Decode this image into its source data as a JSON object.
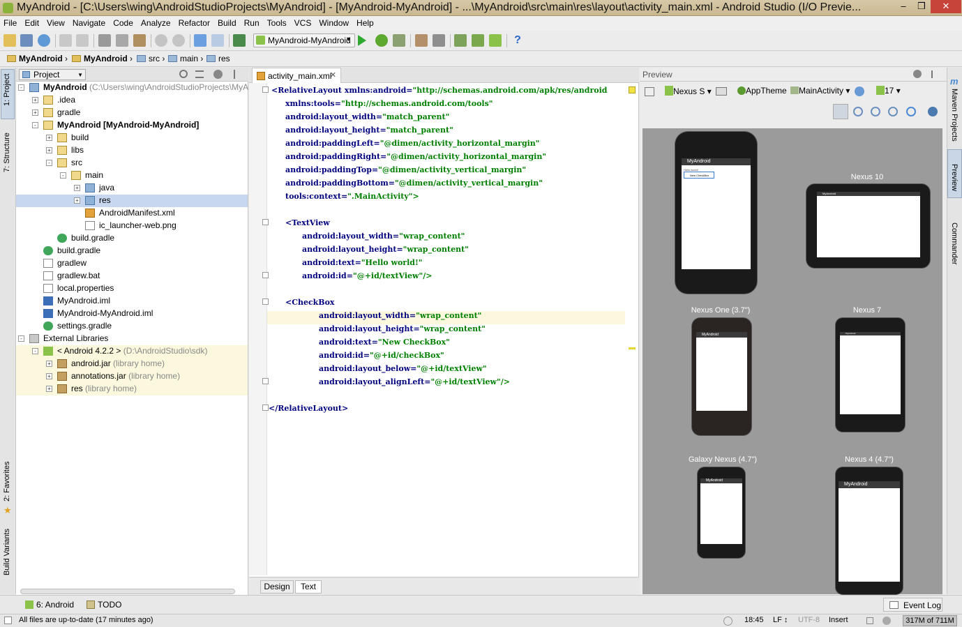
{
  "window": {
    "title": "MyAndroid - [C:\\Users\\wing\\AndroidStudioProjects\\MyAndroid] - [MyAndroid-MyAndroid] - ...\\MyAndroid\\src\\main\\res\\layout\\activity_main.xml - Android Studio (I/O Previe...",
    "min": "–",
    "max": "❒",
    "close": "✕"
  },
  "menu": [
    "File",
    "Edit",
    "View",
    "Navigate",
    "Code",
    "Analyze",
    "Refactor",
    "Build",
    "Run",
    "Tools",
    "VCS",
    "Window",
    "Help"
  ],
  "toolbar": {
    "run_config": "MyAndroid-MyAndroid",
    "help": "?"
  },
  "breadcrumbs": [
    "MyAndroid",
    "MyAndroid",
    "src",
    "main",
    "res"
  ],
  "left_tools": {
    "project": "1: Project",
    "structure": "7: Structure",
    "favorites": "2: Favorites",
    "build_variants": "Build Variants"
  },
  "project": {
    "header": "Project",
    "tree": [
      {
        "label": "MyAndroid",
        "extra": "(C:\\Users\\wing\\AndroidStudioProjects\\MyAndro",
        "bold": true
      },
      {
        "label": ".idea"
      },
      {
        "label": "gradle"
      },
      {
        "label": "MyAndroid [MyAndroid-MyAndroid]",
        "bold": true
      },
      {
        "label": "build"
      },
      {
        "label": "libs"
      },
      {
        "label": "src"
      },
      {
        "label": "main"
      },
      {
        "label": "java"
      },
      {
        "label": "res"
      },
      {
        "label": "AndroidManifest.xml"
      },
      {
        "label": "ic_launcher-web.png"
      },
      {
        "label": "build.gradle"
      },
      {
        "label": "build.gradle"
      },
      {
        "label": "gradlew"
      },
      {
        "label": "gradlew.bat"
      },
      {
        "label": "local.properties"
      },
      {
        "label": "MyAndroid.iml"
      },
      {
        "label": "MyAndroid-MyAndroid.iml"
      },
      {
        "label": "settings.gradle"
      },
      {
        "label": "External Libraries"
      },
      {
        "label": "< Android 4.2.2 >",
        "extra": "(D:\\AndroidStudio\\sdk)"
      },
      {
        "label": "android.jar",
        "extra": "(library home)"
      },
      {
        "label": "annotations.jar",
        "extra": "(library home)"
      },
      {
        "label": "res",
        "extra": "(library home)"
      }
    ]
  },
  "editor": {
    "tab": "activity_main.xml",
    "bottom_tabs": [
      "Design",
      "Text"
    ],
    "code": [
      [
        "<RelativeLayout xmlns:android=",
        "\"http://schemas.android.com/apk/res/android"
      ],
      [
        "xmlns:tools=",
        "\"http://schemas.android.com/tools\""
      ],
      [
        "android:layout_width=",
        "\"match_parent\""
      ],
      [
        "android:layout_height=",
        "\"match_parent\""
      ],
      [
        "android:paddingLeft=",
        "\"@dimen/activity_horizontal_margin\""
      ],
      [
        "android:paddingRight=",
        "\"@dimen/activity_horizontal_margin\""
      ],
      [
        "android:paddingTop=",
        "\"@dimen/activity_vertical_margin\""
      ],
      [
        "android:paddingBottom=",
        "\"@dimen/activity_vertical_margin\""
      ],
      [
        "tools:context=",
        "\".MainActivity\">"
      ],
      [
        "",
        ""
      ],
      [
        "<TextView",
        ""
      ],
      [
        "android:layout_width=",
        "\"wrap_content\""
      ],
      [
        "android:layout_height=",
        "\"wrap_content\""
      ],
      [
        "android:text=",
        "\"Hello world!\""
      ],
      [
        "android:id=",
        "\"@+id/textView\"/>"
      ],
      [
        "",
        ""
      ],
      [
        "<CheckBox",
        ""
      ],
      [
        "android:layout_width=",
        "\"wrap_content\""
      ],
      [
        "android:layout_height=",
        "\"wrap_content\""
      ],
      [
        "android:text=",
        "\"New CheckBox\""
      ],
      [
        "android:id=",
        "\"@+id/checkBox\""
      ],
      [
        "android:layout_below=",
        "\"@+id/textView\""
      ],
      [
        "android:layout_alignLeft=",
        "\"@+id/textView\"/>"
      ],
      [
        "",
        ""
      ],
      [
        "</RelativeLayout>",
        ""
      ]
    ]
  },
  "preview": {
    "header": "Preview",
    "device": "Nexus S",
    "theme": "AppTheme",
    "activity": "MainActivity",
    "api": "17",
    "app_name": "MyAndroid",
    "hello": "Hello world!",
    "checkbox": "New CheckBox",
    "devices": [
      "Nexus 10",
      "Nexus One (3.7\")",
      "Nexus 7",
      "Galaxy Nexus (4.7\")",
      "Nexus 4 (4.7\")"
    ]
  },
  "right_tools": {
    "maven": "Maven Projects",
    "preview": "Preview",
    "commander": "Commander"
  },
  "bottom_tools": {
    "android": "6: Android",
    "todo": "TODO",
    "event_log": "Event Log"
  },
  "status": {
    "message": "All files are up-to-date (17 minutes ago)",
    "pos": "18:45",
    "lf": "LF ↕",
    "enc": "UTF-8",
    "mode": "Insert",
    "mem": "317M of 711M"
  }
}
